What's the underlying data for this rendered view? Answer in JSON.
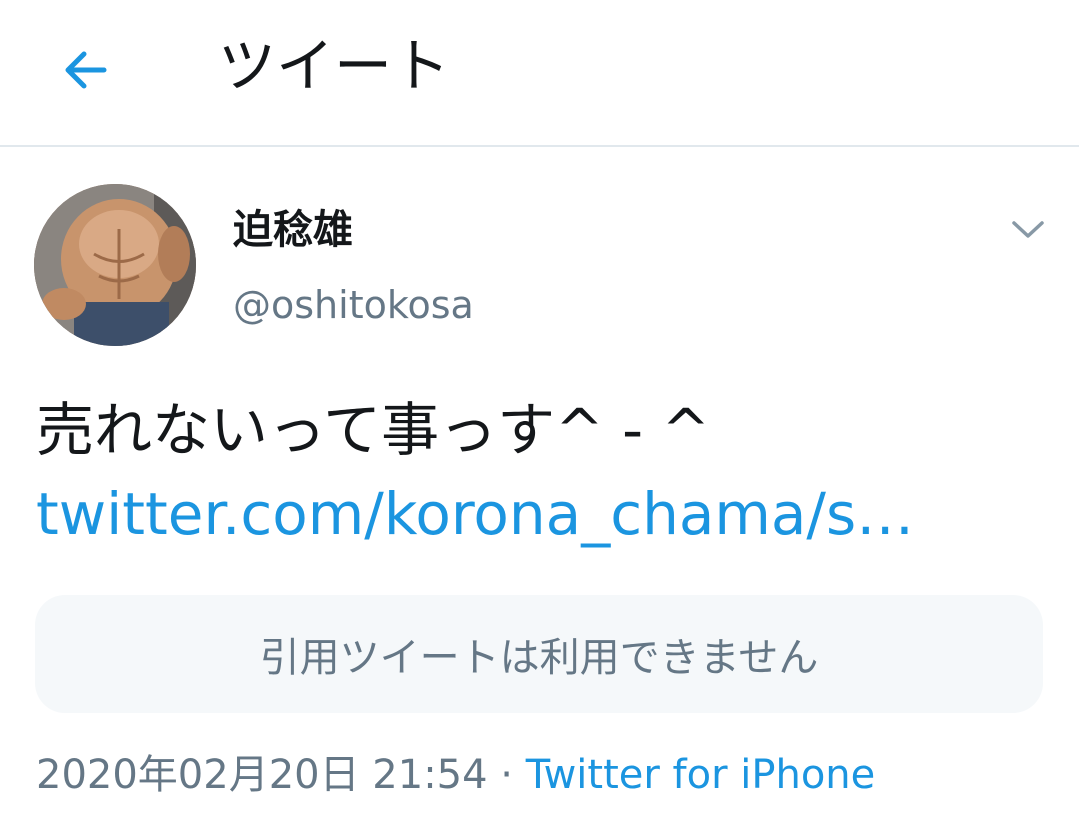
{
  "colors": {
    "accent": "#1b95e0",
    "secondary_text": "#657786",
    "primary_text": "#14171a",
    "divider": "#e1e8ed",
    "quote_bg": "#f5f8fa"
  },
  "header": {
    "back_icon": "arrow-left-icon",
    "title": "ツイート"
  },
  "tweet": {
    "author": {
      "display_name": "迫稔雄",
      "handle": "@oshitokosa"
    },
    "menu_icon": "chevron-down-icon",
    "text": "売れないって事っす^ - ^",
    "link": "twitter.com/korona_chama/s…",
    "quote_unavailable": "引用ツイートは利用できません",
    "timestamp": "2020年02月20日 21:54",
    "separator": " · ",
    "source": "Twitter for iPhone"
  }
}
